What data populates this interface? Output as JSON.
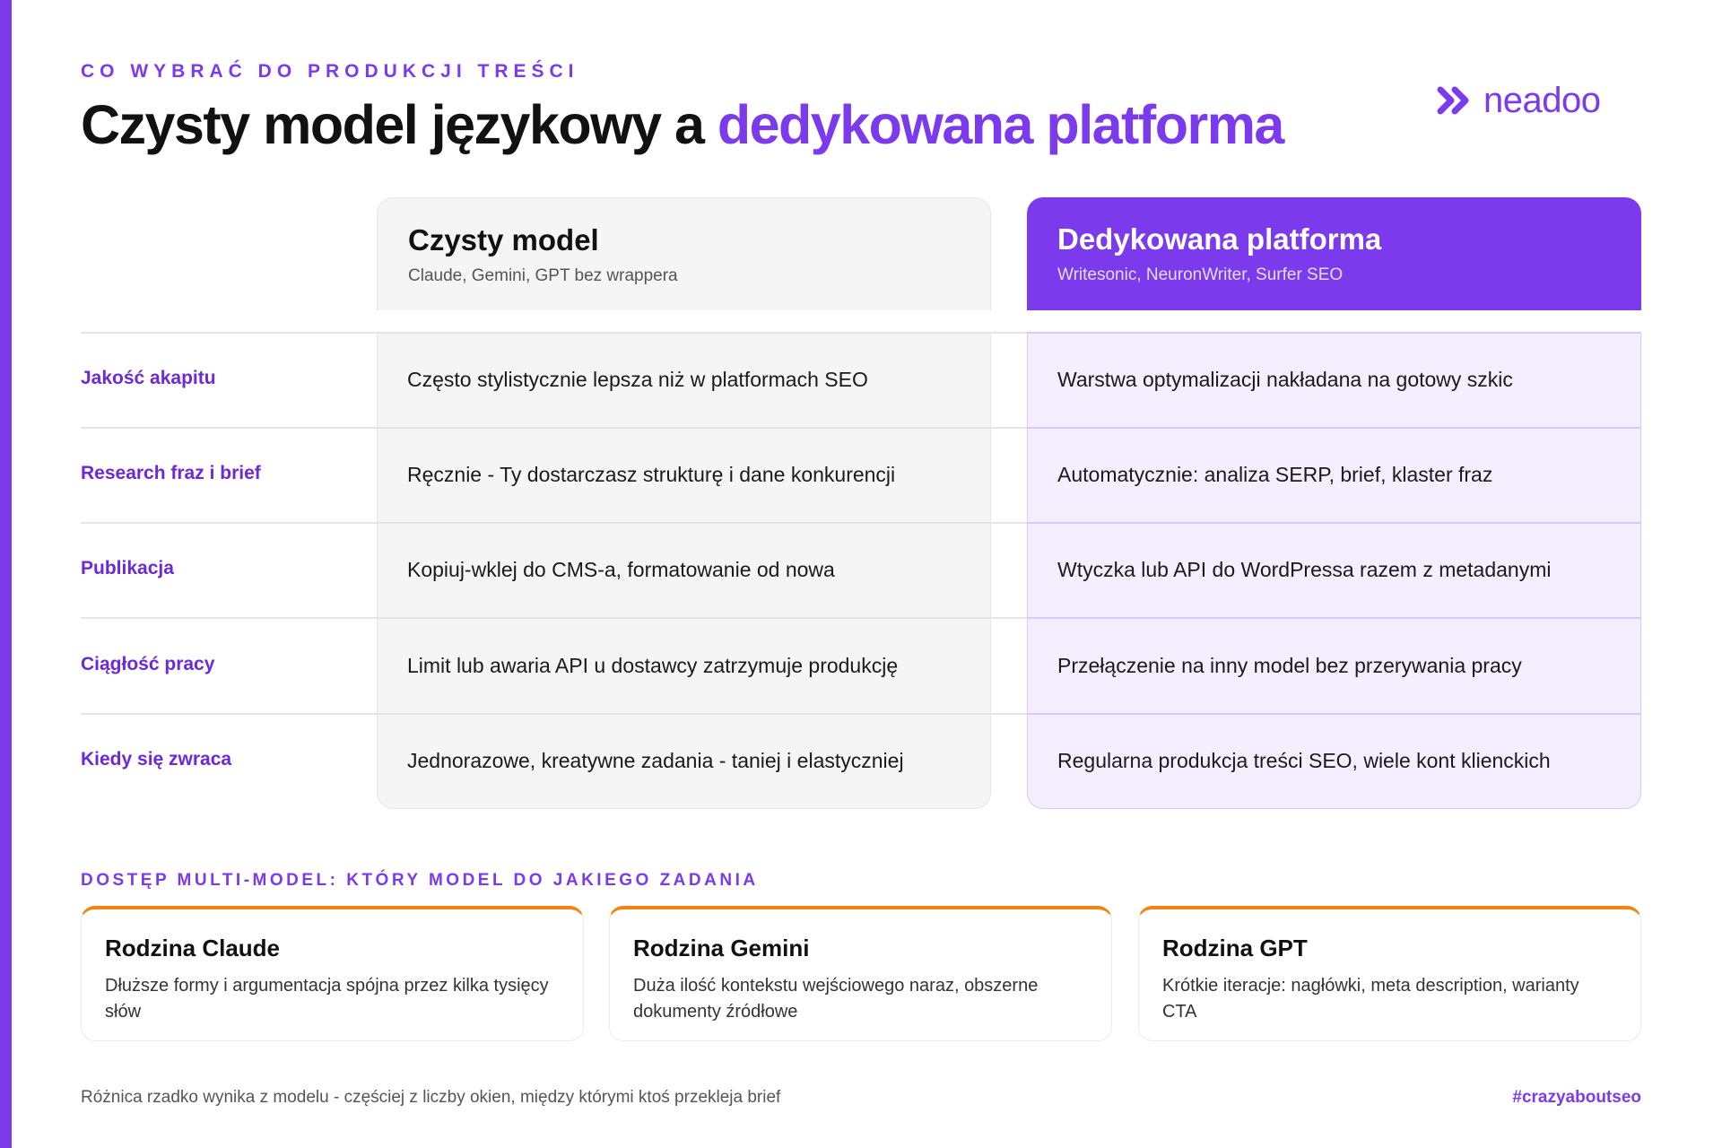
{
  "header": {
    "eyebrow": "CO WYBRAĆ DO PRODUKCJI TREŚCI",
    "title_main": "Czysty model językowy a ",
    "title_accent": "dedykowana platforma",
    "logo_text": "neadoo",
    "logo_icon": "double-chevron-icon"
  },
  "columns": [
    {
      "title": "Czysty model",
      "subtitle": "Claude, Gemini, GPT bez wrappera"
    },
    {
      "title": "Dedykowana platforma",
      "subtitle": "Writesonic, NeuronWriter, Surfer SEO"
    }
  ],
  "rows": [
    {
      "label": "Jakość akapitu",
      "plain": "Często stylistycznie lepsza niż w platformach SEO",
      "platform": "Warstwa optymalizacji nakładana na gotowy szkic"
    },
    {
      "label": "Research fraz i brief",
      "plain": "Ręcznie - Ty dostarczasz strukturę i dane konkurencji",
      "platform": "Automatycznie: analiza SERP, brief, klaster fraz"
    },
    {
      "label": "Publikacja",
      "plain": "Kopiuj-wklej do CMS-a, formatowanie od nowa",
      "platform": "Wtyczka lub API do WordPressa razem z metadanymi"
    },
    {
      "label": "Ciągłość pracy",
      "plain": "Limit lub awaria API u dostawcy zatrzymuje produkcję",
      "platform": "Przełączenie na inny model bez przerywania pracy"
    },
    {
      "label": "Kiedy się zwraca",
      "plain": "Jednorazowe, kreatywne zadania - taniej i elastyczniej",
      "platform": "Regularna produkcja treści SEO, wiele kont klienckich"
    }
  ],
  "multi_model": {
    "label": "DOSTĘP MULTI-MODEL: KTÓRY MODEL DO JAKIEGO ZADANIA",
    "cards": [
      {
        "title": "Rodzina Claude",
        "desc": "Dłuższe formy i argumentacja spójna przez kilka tysięcy słów"
      },
      {
        "title": "Rodzina Gemini",
        "desc": "Duża ilość kontekstu wejściowego naraz, obszerne dokumenty źródłowe"
      },
      {
        "title": "Rodzina GPT",
        "desc": "Krótkie iteracje: nagłówki, meta description, warianty CTA"
      }
    ]
  },
  "footer": {
    "note": "Różnica rzadko wynika z modelu - częściej z liczby okien, między którymi ktoś przekleja brief",
    "hashtag": "#crazyaboutseo"
  },
  "colors": {
    "accent": "#7c3aed",
    "label": "#6d28d9",
    "card_top": "#f5820d",
    "platform_bg": "#f4efff",
    "plain_bg": "#f5f5f5"
  }
}
